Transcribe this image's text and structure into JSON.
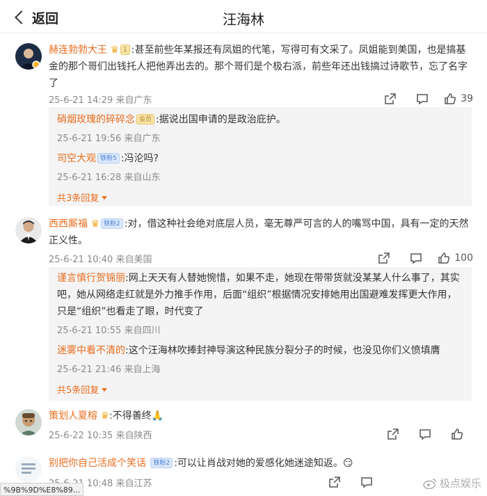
{
  "header": {
    "back_label": "返回",
    "title": "汪海林"
  },
  "comments": [
    {
      "username": "赫连勃勃大王",
      "badge": "1",
      "text": ":甚至前些年某报还有凤姐的代笔，写得可有文采了。凤姐能到美国，也是搞基金的那个哥们出钱托人把他弄出去的。那个哥们是个极右派，前些年还出钱搞过诗歌节，忘了名字了",
      "meta": "25-6-21 14:29 来自广东",
      "likes": "39",
      "replies": [
        {
          "username": "硝烟玫瑰的碎碎念",
          "badge": "会员",
          "text": ":据说出国申请的是政治庇护。",
          "meta": "25-6-21 19:56 来自广东"
        },
        {
          "username": "司空大观",
          "badge": "铁粉5",
          "text": ":冯沦吗?",
          "meta": "25-6-21 16:28 来自山东"
        }
      ],
      "more_replies": "共3条回复"
    },
    {
      "username": "西西厮福",
      "badge": "铁粉2",
      "text": ":对，借这种社会绝对底层人员，毫无尊严可言的人的嘴骂中国，具有一定的天然正义性。",
      "meta": "25-6-21 10:40 来自美国",
      "likes": "100",
      "replies": [
        {
          "username": "谨言慎行贺锦丽",
          "text": ":网上天天有人替她惋惜，如果不走，她现在带带货就没某某人什么事了，其实吧，她从网络走红就是外力推手作用，后面“组织”根据情况安排她用出国避难发挥更大作用，只是“组织”也看走了眼，时代变了",
          "meta": "25-6-21 10:55 来自四川"
        },
        {
          "username": "迷雾中看不清的",
          "text": ":这个汪海林吹捧封神导演这种民族分裂分子的时候，也没见你们义愤填膺",
          "meta": "25-6-21 21:46 来自上海"
        }
      ],
      "more_replies": "共5条回复"
    },
    {
      "username": "策划人夏榕",
      "text": ":不得善终🙏",
      "meta": "25-6-22 10:35 来自陕西"
    },
    {
      "username": "别把你自己活成个笑话",
      "badge": "铁粉2",
      "text": ":可以让肖战对她的爱感化她迷途知返。😏",
      "meta": "25-6-21 10:48 来自江苏"
    }
  ],
  "status_url": "%9B%9D%E8%89...",
  "watermark": "极点娱乐"
}
